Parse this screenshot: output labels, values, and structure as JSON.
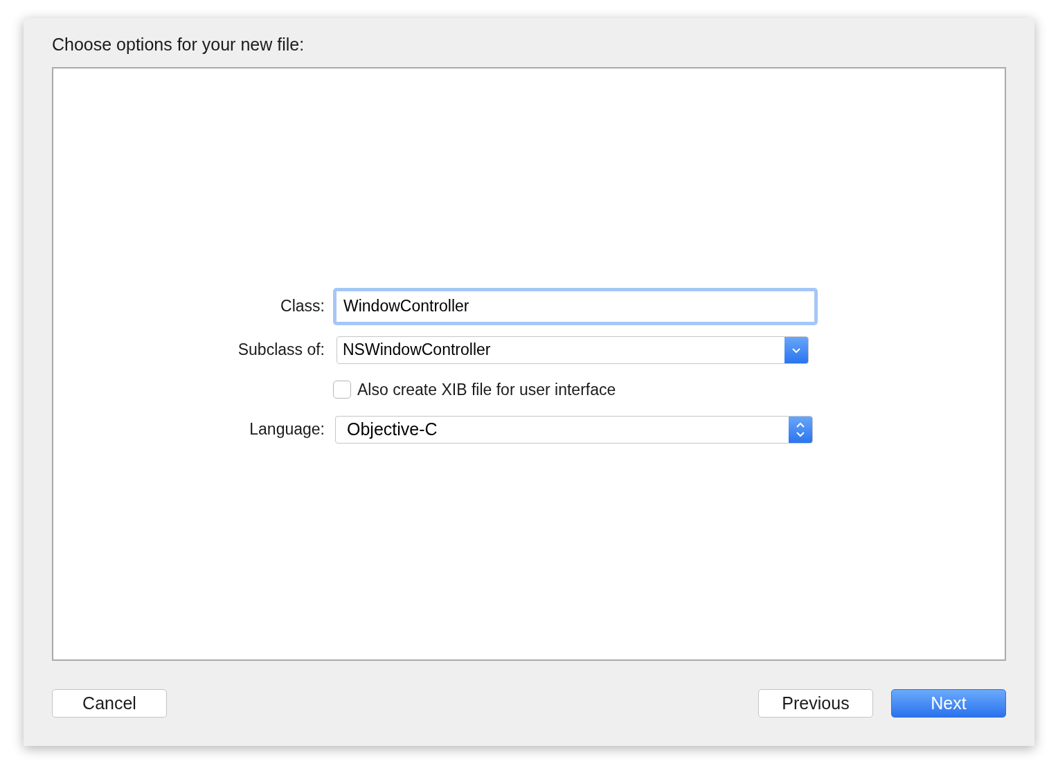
{
  "dialog": {
    "title": "Choose options for your new file:"
  },
  "form": {
    "rows": [
      {
        "kind": "text",
        "label": "Class:",
        "value": "WindowController",
        "focused": true
      },
      {
        "kind": "pulldown",
        "label": "Subclass of:",
        "value": "NSWindowController"
      },
      {
        "kind": "checkbox",
        "label": "Also create XIB file for user interface",
        "checked": false
      },
      {
        "kind": "popup",
        "label": "Language:",
        "value": "Objective-C"
      }
    ]
  },
  "footer": {
    "left_buttons": [
      {
        "label": "Cancel",
        "default": false
      }
    ],
    "right_buttons": [
      {
        "label": "Previous",
        "default": false
      },
      {
        "label": "Next",
        "default": true
      }
    ]
  }
}
